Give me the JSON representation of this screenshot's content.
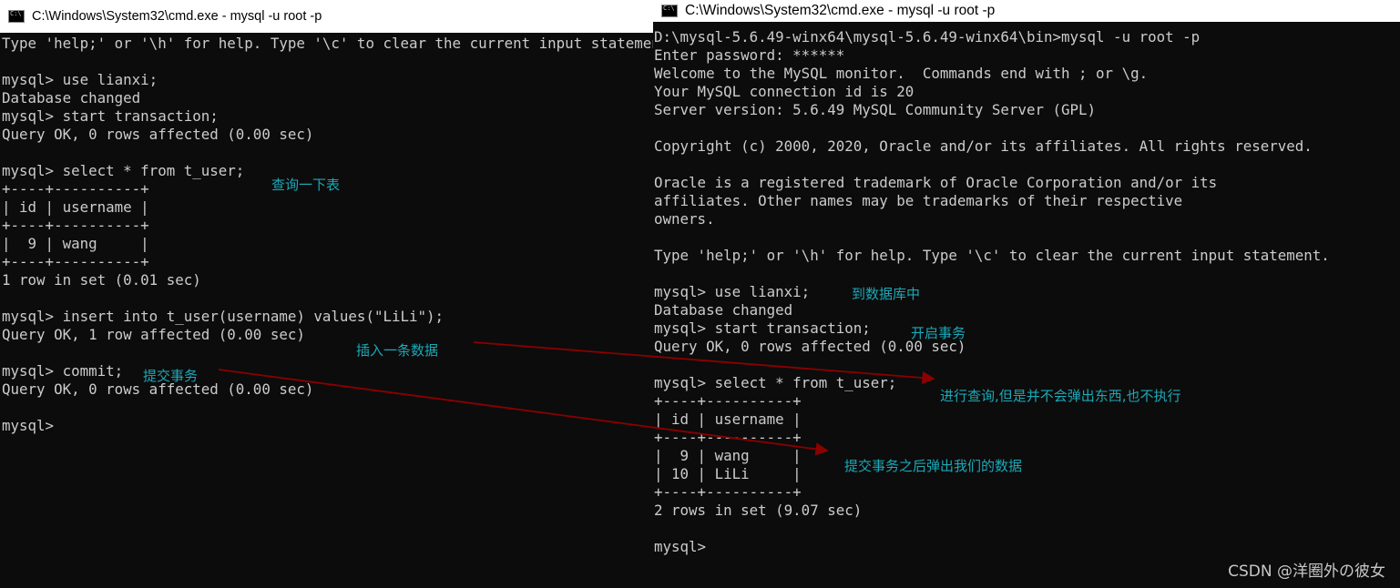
{
  "left_window": {
    "title": "C:\\Windows\\System32\\cmd.exe - mysql  -u root -p",
    "lines": [
      "Type 'help;' or '\\h' for help. Type '\\c' to clear the current input statement.",
      "",
      "mysql> use lianxi;",
      "Database changed",
      "mysql> start transaction;",
      "Query OK, 0 rows affected (0.00 sec)",
      "",
      "mysql> select * from t_user;",
      "+----+----------+",
      "| id | username |",
      "+----+----------+",
      "|  9 | wang     |",
      "+----+----------+",
      "1 row in set (0.01 sec)",
      "",
      "mysql> insert into t_user(username) values(\"LiLi\");",
      "Query OK, 1 row affected (0.00 sec)",
      "",
      "mysql> commit;",
      "Query OK, 0 rows affected (0.00 sec)",
      "",
      "mysql>"
    ]
  },
  "right_window": {
    "title": "C:\\Windows\\System32\\cmd.exe - mysql  -u root -p",
    "lines": [
      "D:\\mysql-5.6.49-winx64\\mysql-5.6.49-winx64\\bin>mysql -u root -p",
      "Enter password: ******",
      "Welcome to the MySQL monitor.  Commands end with ; or \\g.",
      "Your MySQL connection id is 20",
      "Server version: 5.6.49 MySQL Community Server (GPL)",
      "",
      "Copyright (c) 2000, 2020, Oracle and/or its affiliates. All rights reserved.",
      "",
      "Oracle is a registered trademark of Oracle Corporation and/or its",
      "affiliates. Other names may be trademarks of their respective",
      "owners.",
      "",
      "Type 'help;' or '\\h' for help. Type '\\c' to clear the current input statement.",
      "",
      "mysql> use lianxi;",
      "Database changed",
      "mysql> start transaction;",
      "Query OK, 0 rows affected (0.00 sec)",
      "",
      "mysql> select * from t_user;",
      "+----+----------+",
      "| id | username |",
      "+----+----------+",
      "|  9 | wang     |",
      "| 10 | LiLi     |",
      "+----+----------+",
      "2 rows in set (9.07 sec)",
      "",
      "mysql>"
    ]
  },
  "annotations": {
    "query_table": "查询一下表",
    "insert_data": "插入一条数据",
    "commit_tx": "提交事务",
    "to_database": "到数据库中",
    "start_tx": "开启事务",
    "query_blocked": "进行查询,但是并不会弹出东西,也不执行",
    "after_commit": "提交事务之后弹出我们的数据"
  },
  "watermark": "CSDN @洋圈外の彼女",
  "colors": {
    "console_bg": "#0c0c0c",
    "console_text": "#cccccc",
    "annotation": "#1ba9b8",
    "arrow": "#8b0000"
  }
}
